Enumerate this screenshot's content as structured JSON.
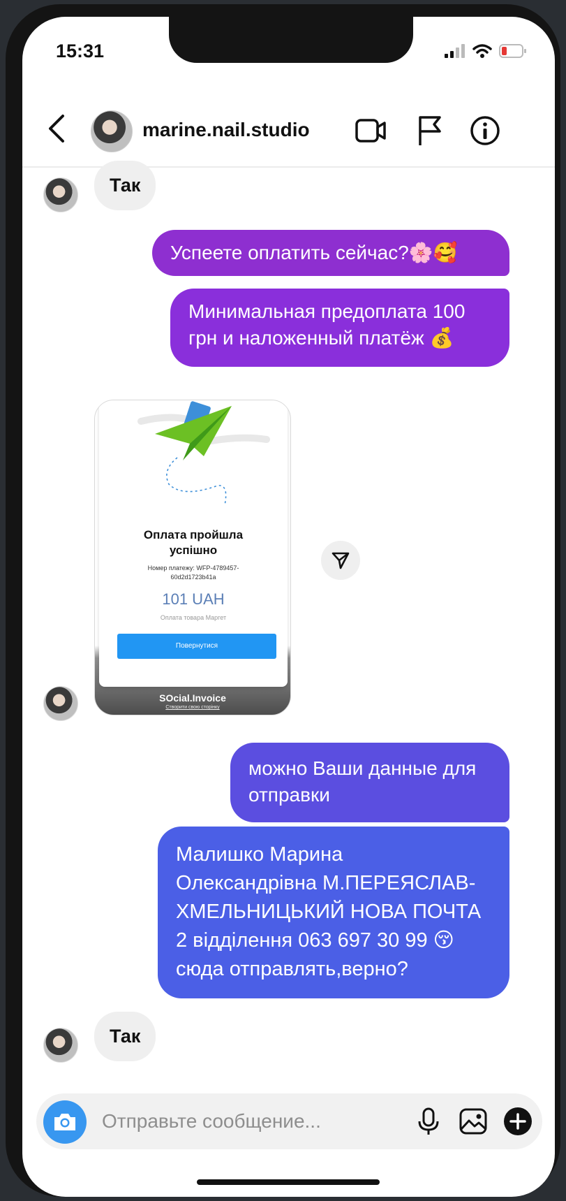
{
  "status_bar": {
    "time": "15:31"
  },
  "header": {
    "username": "marine.nail.studio",
    "icons": [
      "back-chevron-icon",
      "video-camera-icon",
      "flag-icon",
      "info-icon"
    ]
  },
  "messages": {
    "in_1": "Так",
    "out_1": "Успеете оплатить сейчас?🌸🥰",
    "out_2_line1": "Минимальная предоплата 100",
    "out_2_line2": "грн и наложенный платёж 💰",
    "payment_card": {
      "title": "Оплата пройшла успішно",
      "number": "Номер платежу: WFP-4789457-60d2d1723b41a",
      "amount": "101 UAH",
      "description": "Оплата товара Маргет",
      "button": "Повернутися",
      "brand": "SOcial.Invoice",
      "link": "Створити свою сторінку"
    },
    "out_3_line1": "можно Ваши данные для",
    "out_3_line2": "отправки",
    "out_4_line1": "Малишко Марина",
    "out_4_line2": "Олександрівна М.ПЕРЕЯСЛАВ-",
    "out_4_line3": "ХМЕЛЬНИЦЬКИЙ НОВА ПОЧТА",
    "out_4_line4": "2 відділення 063 697 30 99 😚",
    "out_4_line5": "сюда отправлять,верно?",
    "in_2": "Так"
  },
  "composer": {
    "placeholder": "Отправьте сообщение...",
    "icons": [
      "camera-icon",
      "microphone-icon",
      "gallery-icon",
      "plus-icon"
    ]
  },
  "colors": {
    "bubble_purple": "#8e2fd0",
    "bubble_violet": "#5b4ee0",
    "bubble_blue": "#4b5fe6",
    "incoming": "#efefef",
    "camera_blue": "#3897f0"
  }
}
